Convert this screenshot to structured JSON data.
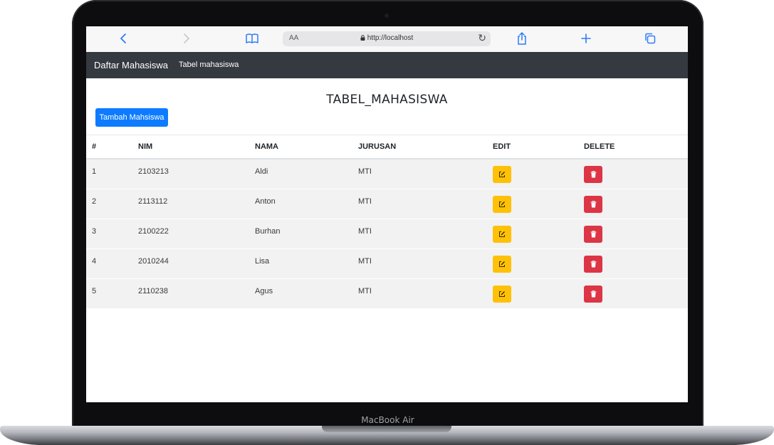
{
  "device": {
    "model_label": "MacBook Air"
  },
  "browser": {
    "text_size_label": "AA",
    "url": "http://localhost"
  },
  "navbar": {
    "brand": "Daftar Mahasiswa",
    "link": "Tabel mahasiswa"
  },
  "page": {
    "title": "TABEL_MAHASISWA",
    "add_button_label": "Tambah Mahsiswa"
  },
  "table": {
    "headers": [
      "#",
      "NIM",
      "NAMA",
      "JURUSAN",
      "EDIT",
      "DELETE"
    ],
    "rows": [
      {
        "no": "1",
        "nim": "2103213",
        "nama": "Aldi",
        "jurusan": "MTI"
      },
      {
        "no": "2",
        "nim": "2113112",
        "nama": "Anton",
        "jurusan": "MTI"
      },
      {
        "no": "3",
        "nim": "2100222",
        "nama": "Burhan",
        "jurusan": "MTI"
      },
      {
        "no": "4",
        "nim": "2010244",
        "nama": "Lisa",
        "jurusan": "MTI"
      },
      {
        "no": "5",
        "nim": "2110238",
        "nama": "Agus",
        "jurusan": "MTI"
      }
    ]
  },
  "colors": {
    "navbar": "#343a40",
    "primary": "#0d7bff",
    "warning": "#ffc107",
    "danger": "#dc3545",
    "safari_accent": "#2f7bf6"
  },
  "icons": {
    "edit": "edit-icon",
    "delete": "trash-icon"
  }
}
